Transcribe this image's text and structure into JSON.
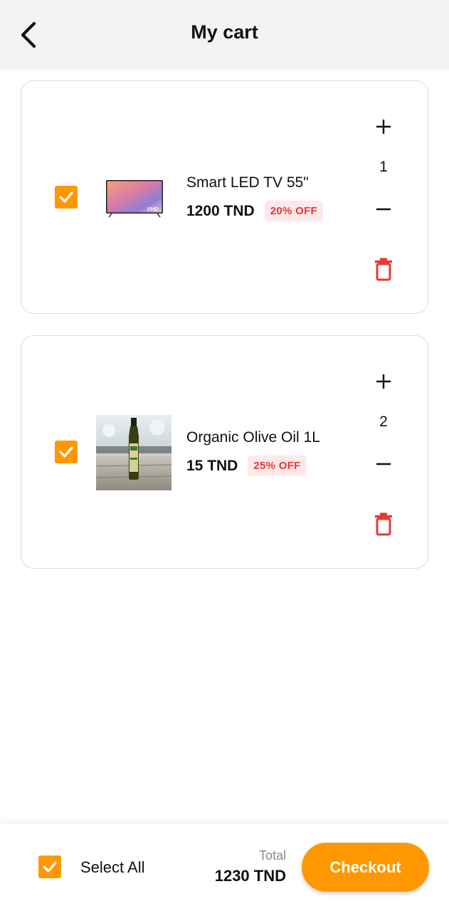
{
  "header": {
    "title": "My cart",
    "back_icon": "chevron-left-icon"
  },
  "colors": {
    "accent": "#FF9800",
    "danger": "#E53935",
    "badge_bg": "#FDE8EA",
    "badge_text": "#E53935",
    "appbar_bg": "#F2F2F4"
  },
  "cart": {
    "items": [
      {
        "name": "Smart LED TV 55\"",
        "price": "1200 TND",
        "discount": "20% OFF",
        "quantity": "1",
        "checked": true,
        "image_icon": "tv-image"
      },
      {
        "name": "Organic Olive Oil 1L",
        "price": "15 TND",
        "discount": "25% OFF",
        "quantity": "2",
        "checked": true,
        "image_icon": "olive-oil-bottle-image"
      }
    ]
  },
  "footer": {
    "select_all_label": "Select All",
    "select_all_checked": true,
    "total_label": "Total",
    "total_value": "1230 TND",
    "checkout_label": "Checkout"
  }
}
